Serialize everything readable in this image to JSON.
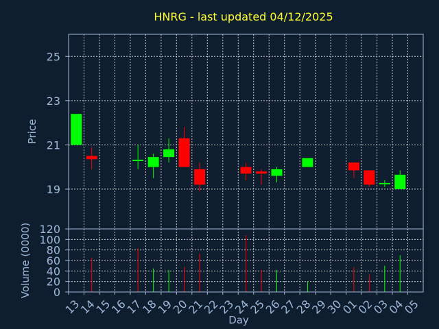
{
  "title": "HNRG - last updated 04/12/2025",
  "colors": {
    "background": "#0f1e2f",
    "up": "#00ff00",
    "down": "#ff0000",
    "title": "#ffff33",
    "axis": "#9fb8d8",
    "grid": "#c8c8c8"
  },
  "chart_data": [
    {
      "type": "candlestick",
      "ylabel": "Price",
      "ylim": [
        17.2,
        26
      ],
      "yticks": [
        19,
        21,
        23,
        25
      ],
      "grid": true,
      "candles": [
        {
          "day": "13",
          "open": 21.0,
          "high": 22.4,
          "low": 21.0,
          "close": 22.4
        },
        {
          "day": "14",
          "open": 20.5,
          "high": 20.9,
          "low": 19.9,
          "close": 20.35
        },
        {
          "day": "17",
          "open": 20.3,
          "high": 21.0,
          "low": 19.9,
          "close": 20.3
        },
        {
          "day": "18",
          "open": 20.0,
          "high": 20.6,
          "low": 19.5,
          "close": 20.45
        },
        {
          "day": "19",
          "open": 20.45,
          "high": 21.3,
          "low": 20.2,
          "close": 20.8
        },
        {
          "day": "20",
          "open": 21.3,
          "high": 21.8,
          "low": 20.0,
          "close": 20.0
        },
        {
          "day": "21",
          "open": 19.9,
          "high": 20.2,
          "low": 18.9,
          "close": 19.2
        },
        {
          "day": "24",
          "open": 20.0,
          "high": 20.2,
          "low": 19.4,
          "close": 19.7
        },
        {
          "day": "25",
          "open": 19.8,
          "high": 19.9,
          "low": 19.2,
          "close": 19.7
        },
        {
          "day": "26",
          "open": 19.6,
          "high": 20.0,
          "low": 19.3,
          "close": 19.9
        },
        {
          "day": "28",
          "open": 20.0,
          "high": 20.4,
          "low": 20.0,
          "close": 20.4
        },
        {
          "day": "01",
          "open": 20.2,
          "high": 20.2,
          "low": 19.5,
          "close": 19.85
        },
        {
          "day": "02",
          "open": 19.85,
          "high": 19.85,
          "low": 19.1,
          "close": 19.2
        },
        {
          "day": "03",
          "open": 19.2,
          "high": 19.4,
          "low": 19.1,
          "close": 19.25
        },
        {
          "day": "04",
          "open": 19.0,
          "high": 19.85,
          "low": 19.0,
          "close": 19.65
        }
      ]
    },
    {
      "type": "bar",
      "ylabel": "Volume (0000)",
      "xlabel": "Day",
      "ylim": [
        0,
        120
      ],
      "yticks": [
        0,
        20,
        40,
        60,
        80,
        100,
        120
      ],
      "grid": true,
      "categories": [
        "13",
        "14",
        "15",
        "16",
        "17",
        "18",
        "19",
        "20",
        "21",
        "22",
        "23",
        "24",
        "25",
        "26",
        "27",
        "28",
        "29",
        "30",
        "01",
        "02",
        "03",
        "04",
        "05"
      ],
      "values": [
        0,
        65,
        0,
        0,
        83,
        45,
        42,
        48,
        73,
        0,
        0,
        108,
        42,
        42,
        0,
        20,
        0,
        0,
        47,
        33,
        50,
        70,
        0
      ],
      "bar_direction": [
        "",
        "down",
        "",
        "",
        "down",
        "up",
        "up",
        "down",
        "down",
        "",
        "",
        "down",
        "down",
        "up",
        "",
        "up",
        "",
        "",
        "down",
        "down",
        "up",
        "up",
        ""
      ]
    }
  ]
}
